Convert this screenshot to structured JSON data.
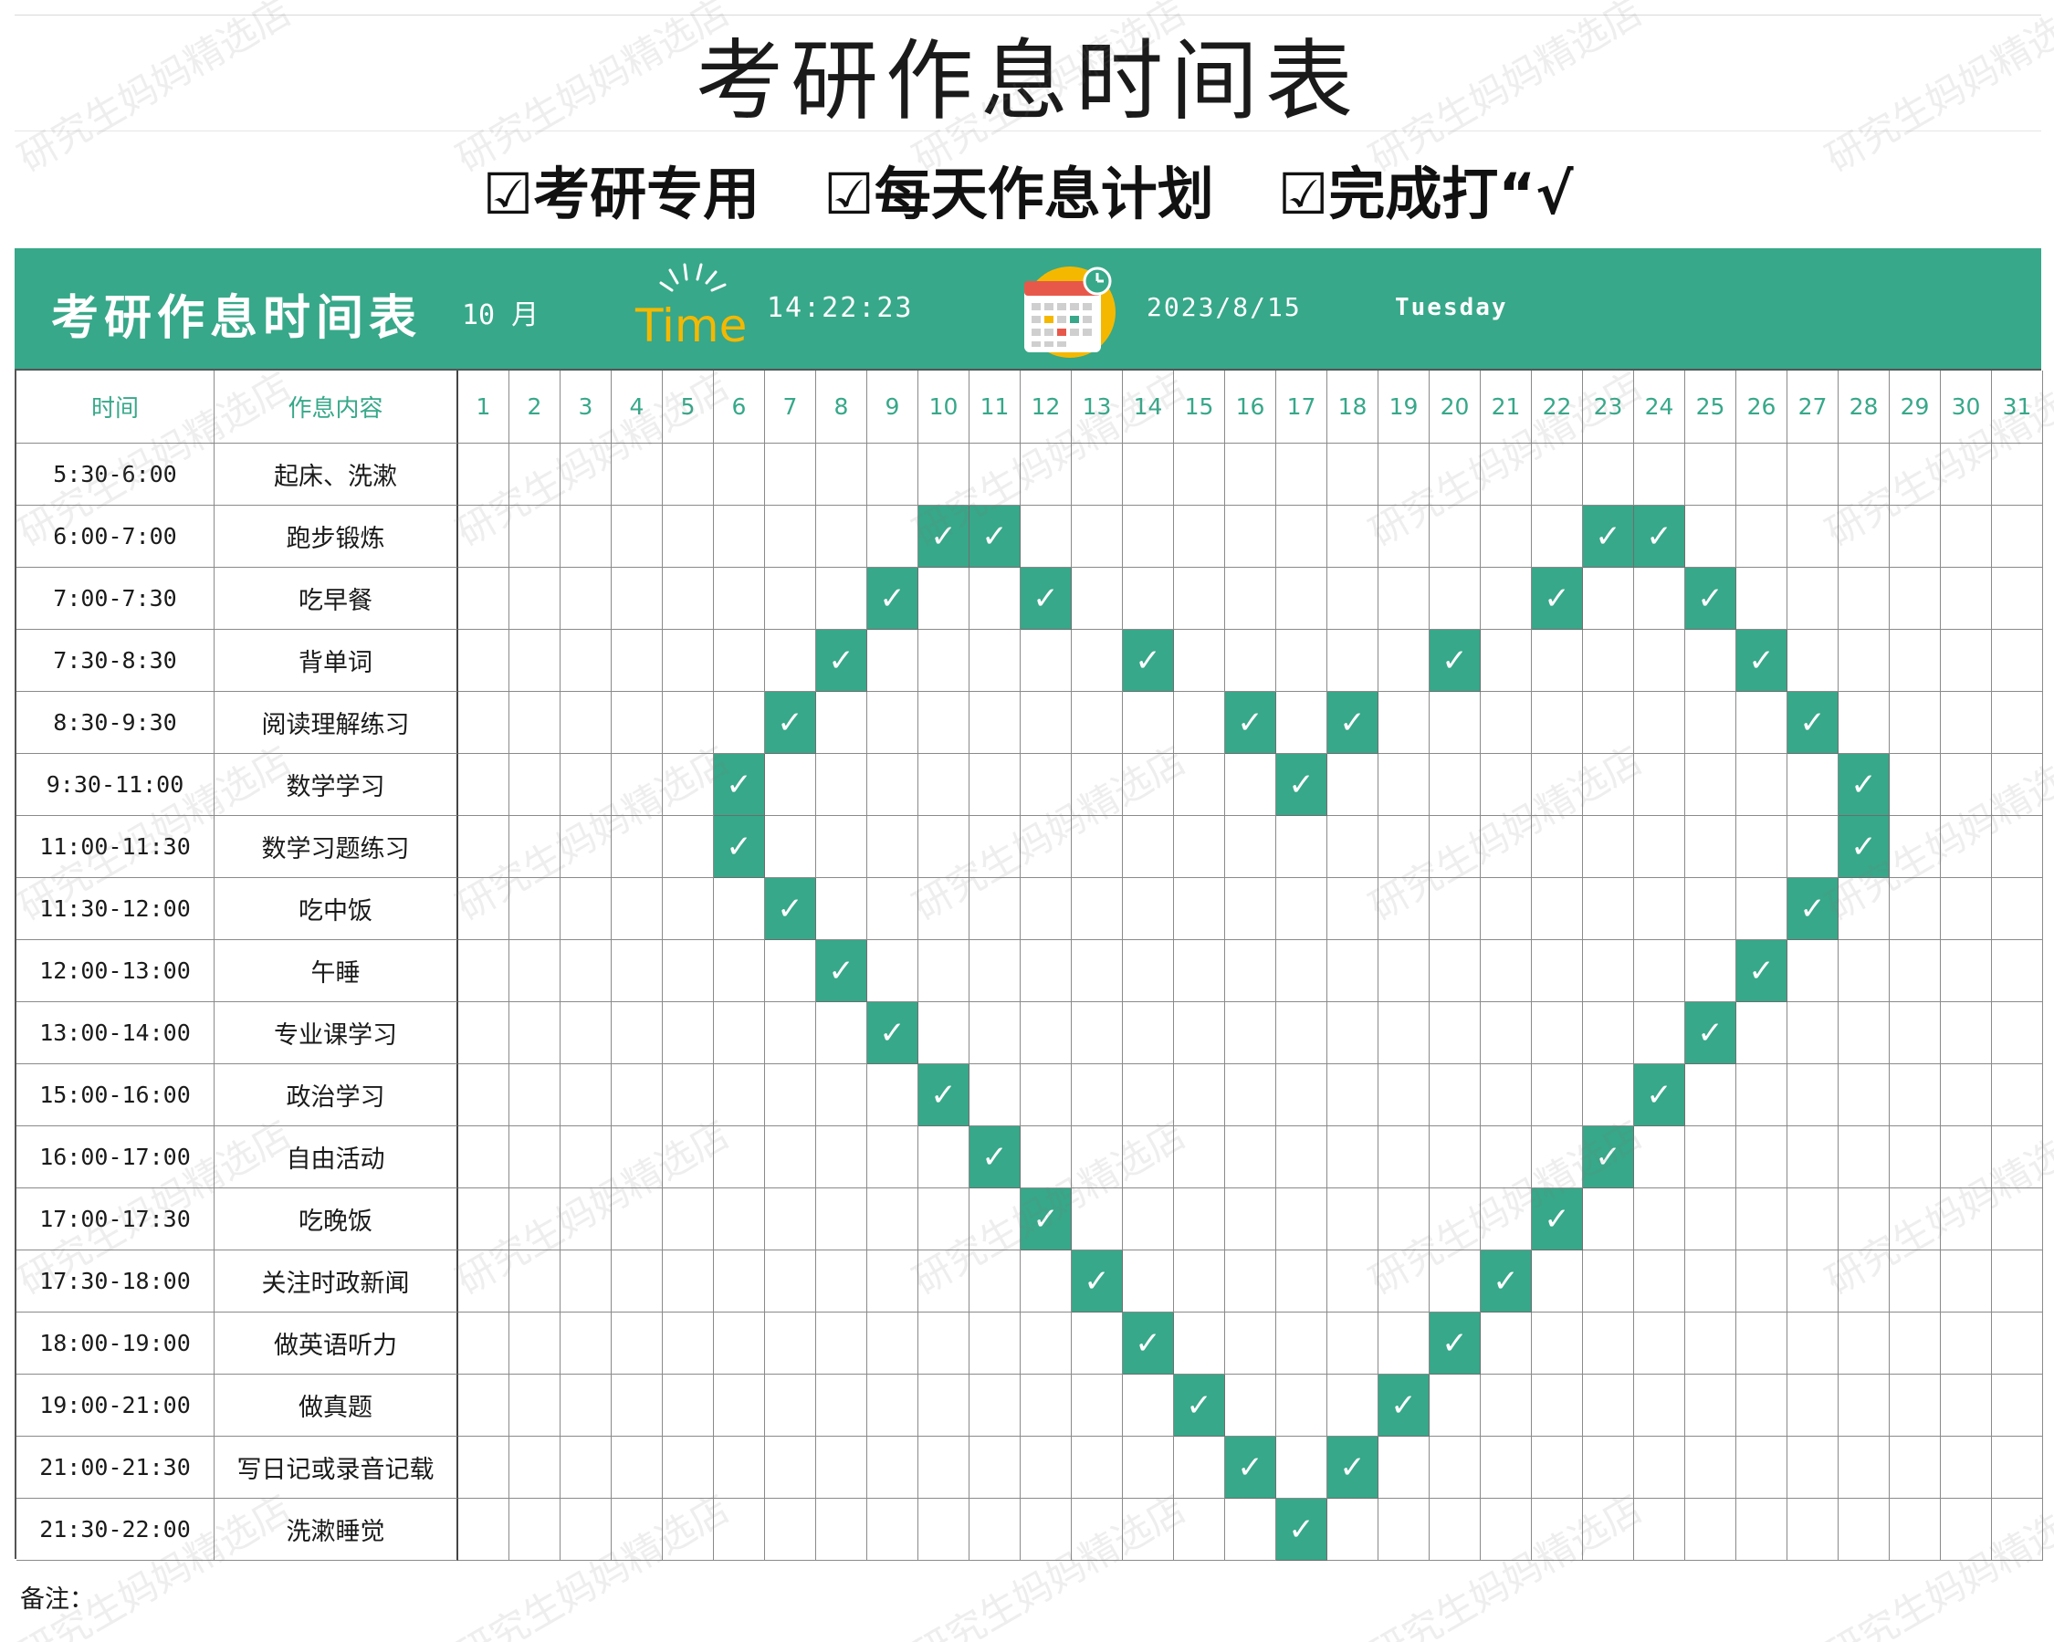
{
  "document": {
    "main_title": "考研作息时间表",
    "tags": [
      "☑考研专用",
      "☑每天作息计划",
      "☑完成打“√"
    ],
    "banner": {
      "title": "考研作息时间表",
      "month": "10 月",
      "logo_text": "Time",
      "clock": "14:22:23",
      "date": "2023/8/15",
      "weekday": "Tuesday"
    },
    "table": {
      "header_time": "时间",
      "header_activity": "作息内容",
      "days": [
        "1",
        "2",
        "3",
        "4",
        "5",
        "6",
        "7",
        "8",
        "9",
        "10",
        "11",
        "12",
        "13",
        "14",
        "15",
        "16",
        "17",
        "18",
        "19",
        "20",
        "21",
        "22",
        "23",
        "24",
        "25",
        "26",
        "27",
        "28",
        "29",
        "30",
        "31"
      ],
      "check_symbol": "✓",
      "rows": [
        {
          "time": "5:30-6:00",
          "activity": "起床、洗漱",
          "checked_days": []
        },
        {
          "time": "6:00-7:00",
          "activity": "跑步锻炼",
          "checked_days": [
            10,
            11,
            23,
            24
          ]
        },
        {
          "time": "7:00-7:30",
          "activity": "吃早餐",
          "checked_days": [
            9,
            12,
            22,
            25
          ]
        },
        {
          "time": "7:30-8:30",
          "activity": "背单词",
          "checked_days": [
            8,
            14,
            20,
            26
          ]
        },
        {
          "time": "8:30-9:30",
          "activity": "阅读理解练习",
          "checked_days": [
            7,
            16,
            18,
            27
          ]
        },
        {
          "time": "9:30-11:00",
          "activity": "数学学习",
          "checked_days": [
            6,
            17,
            28
          ]
        },
        {
          "time": "11:00-11:30",
          "activity": "数学习题练习",
          "checked_days": [
            6,
            28
          ]
        },
        {
          "time": "11:30-12:00",
          "activity": "吃中饭",
          "checked_days": [
            7,
            27
          ]
        },
        {
          "time": "12:00-13:00",
          "activity": "午睡",
          "checked_days": [
            8,
            26
          ]
        },
        {
          "time": "13:00-14:00",
          "activity": "专业课学习",
          "checked_days": [
            9,
            25
          ]
        },
        {
          "time": "15:00-16:00",
          "activity": "政治学习",
          "checked_days": [
            10,
            24
          ]
        },
        {
          "time": "16:00-17:00",
          "activity": "自由活动",
          "checked_days": [
            11,
            23
          ]
        },
        {
          "time": "17:00-17:30",
          "activity": "吃晚饭",
          "checked_days": [
            12,
            22
          ]
        },
        {
          "time": "17:30-18:00",
          "activity": "关注时政新闻",
          "checked_days": [
            13,
            21
          ]
        },
        {
          "time": "18:00-19:00",
          "activity": "做英语听力",
          "checked_days": [
            14,
            20
          ]
        },
        {
          "time": "19:00-21:00",
          "activity": "做真题",
          "checked_days": [
            15,
            19
          ]
        },
        {
          "time": "21:00-21:30",
          "activity": "写日记或录音记载",
          "checked_days": [
            16,
            18
          ]
        },
        {
          "time": "21:30-22:00",
          "activity": "洗漱睡觉",
          "checked_days": [
            17
          ]
        }
      ]
    },
    "note_label": "备注：",
    "watermark": "研究生妈妈精选店",
    "colors": {
      "accent": "#37a889",
      "logo_yellow": "#f5b800",
      "grid_line": "#8a8a8a"
    }
  }
}
